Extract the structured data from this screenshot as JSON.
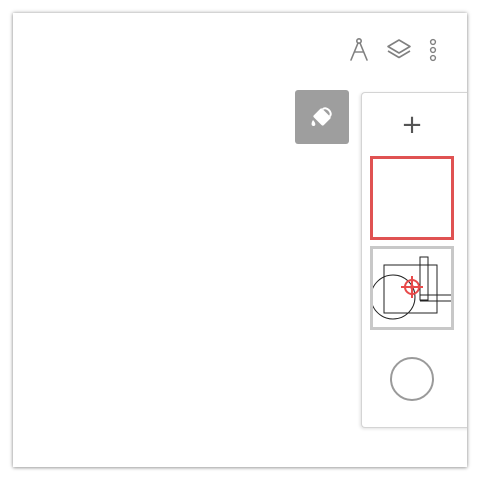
{
  "toolbar": {
    "items": [
      {
        "name": "compass-icon"
      },
      {
        "name": "layers-icon"
      },
      {
        "name": "more-vertical-icon"
      }
    ]
  },
  "fill_tool": {
    "icon": "paint-bucket-icon"
  },
  "layers": {
    "add_label": "+",
    "items": [
      {
        "name": "empty-layer",
        "selected": true
      },
      {
        "name": "drawing-layer",
        "selected": false
      },
      {
        "name": "circle-layer",
        "selected": false
      }
    ]
  },
  "colors": {
    "selected_border": "#e05252",
    "thumb_border": "#c8c8c8",
    "button_gray": "#9e9e9e",
    "icon_gray": "#808080",
    "accent_red": "#e84a4a"
  }
}
